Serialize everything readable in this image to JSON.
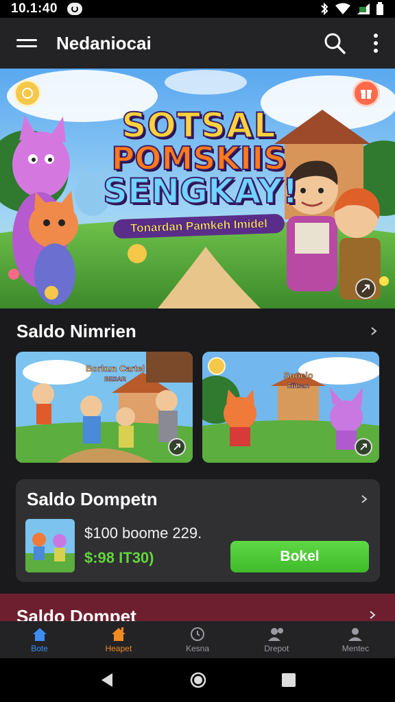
{
  "status_bar": {
    "time": "10.1:40"
  },
  "app_bar": {
    "title": "Nedaniocai"
  },
  "hero": {
    "title_lines": [
      "SOTSAL",
      "POMSKIIS",
      "SENGKAY!"
    ],
    "tagline": "Tonardan Pamkeh Imidel"
  },
  "section": {
    "title": "Saldo Nimrien"
  },
  "cards": [
    {
      "title": "Borkun Cartel",
      "subtitle": "BESAR"
    },
    {
      "title": "Sooclo",
      "subtitle": "Eiitsan"
    }
  ],
  "wallet": {
    "title": "Saldo Dompetn",
    "line1": "$100 boome 229.",
    "line2": "$:98 IT30)",
    "button_label": "Bokel"
  },
  "next_section": {
    "title": "Saldo Dompet"
  },
  "bottom_nav": [
    {
      "label": "Bote",
      "icon": "home-icon"
    },
    {
      "label": "Heapet",
      "icon": "shop-icon"
    },
    {
      "label": "Kesna",
      "icon": "timer-icon"
    },
    {
      "label": "Drepot",
      "icon": "users-icon"
    },
    {
      "label": "Mentec",
      "icon": "profile-icon"
    }
  ],
  "colors": {
    "accent_blue": "#3d8df5",
    "accent_orange": "#f08a22",
    "button_green": "#4cc937",
    "amount_green": "#62d63a",
    "background": "#1a1a1c"
  }
}
